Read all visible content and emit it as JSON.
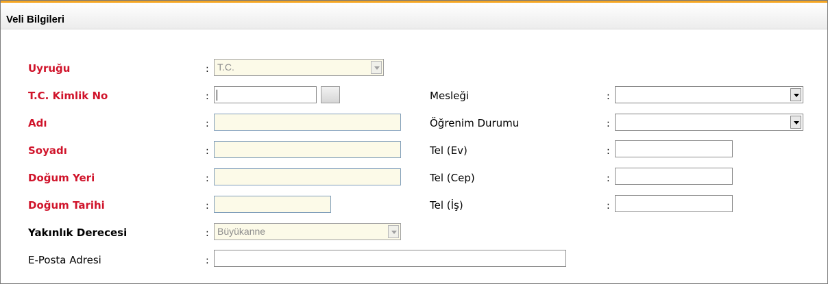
{
  "panel": {
    "title": "Veli Bilgileri"
  },
  "form": {
    "uyrugu": {
      "label": "Uyruğu",
      "value": "T.C."
    },
    "tc_kimlik_no": {
      "label": "T.C. Kimlik No",
      "value": ""
    },
    "adi": {
      "label": "Adı",
      "value": ""
    },
    "soyadi": {
      "label": "Soyadı",
      "value": ""
    },
    "dogum_yeri": {
      "label": "Doğum Yeri",
      "value": ""
    },
    "dogum_tarihi": {
      "label": "Doğum Tarihi",
      "value": ""
    },
    "yakinlik_derecesi": {
      "label": "Yakınlık Derecesi",
      "value": "Büyükanne"
    },
    "eposta": {
      "label": "E-Posta Adresi",
      "value": ""
    },
    "meslegi": {
      "label": "Mesleği",
      "value": ""
    },
    "ogrenim_durumu": {
      "label": "Öğrenim Durumu",
      "value": ""
    },
    "tel_ev": {
      "label": "Tel (Ev)",
      "value": ""
    },
    "tel_cep": {
      "label": "Tel (Cep)",
      "value": ""
    },
    "tel_is": {
      "label": "Tel (İş)",
      "value": ""
    },
    "separator": ":"
  },
  "colors": {
    "required_label": "#d0142b",
    "input_bg": "#fcfae8",
    "header_accent": "#f5a623"
  },
  "icons": {
    "dropdown": "chevron-down-icon",
    "lookup": "lookup-button"
  }
}
